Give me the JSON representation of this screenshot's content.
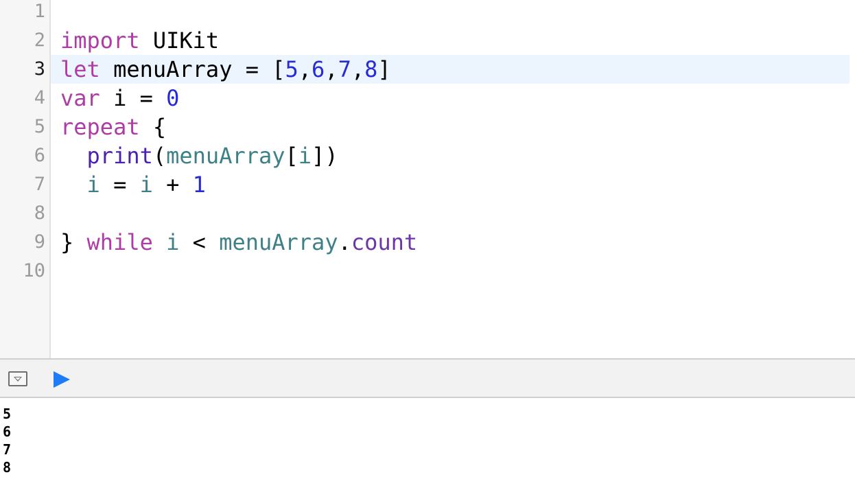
{
  "editor": {
    "line_numbers": [
      "1",
      "2",
      "3",
      "4",
      "5",
      "6",
      "7",
      "8",
      "9",
      "10"
    ],
    "active_line": 3,
    "lines": [
      [],
      [
        {
          "t": "import",
          "c": "kw"
        },
        {
          "t": " UIKit",
          "c": "plain"
        }
      ],
      [
        {
          "t": "let",
          "c": "kw"
        },
        {
          "t": " menuArray = [",
          "c": "plain"
        },
        {
          "t": "5",
          "c": "num"
        },
        {
          "t": ",",
          "c": "plain"
        },
        {
          "t": "6",
          "c": "num"
        },
        {
          "t": ",",
          "c": "plain"
        },
        {
          "t": "7",
          "c": "num"
        },
        {
          "t": ",",
          "c": "plain"
        },
        {
          "t": "8",
          "c": "num"
        },
        {
          "t": "]",
          "c": "plain"
        }
      ],
      [
        {
          "t": "var",
          "c": "kw"
        },
        {
          "t": " i = ",
          "c": "plain"
        },
        {
          "t": "0",
          "c": "num"
        }
      ],
      [
        {
          "t": "repeat",
          "c": "kw"
        },
        {
          "t": " {",
          "c": "plain"
        }
      ],
      [
        {
          "t": "  ",
          "c": "plain"
        },
        {
          "t": "print",
          "c": "fn"
        },
        {
          "t": "(",
          "c": "plain"
        },
        {
          "t": "menuArray",
          "c": "var"
        },
        {
          "t": "[",
          "c": "plain"
        },
        {
          "t": "i",
          "c": "var"
        },
        {
          "t": "])",
          "c": "plain"
        }
      ],
      [
        {
          "t": "  ",
          "c": "plain"
        },
        {
          "t": "i",
          "c": "var"
        },
        {
          "t": " = ",
          "c": "plain"
        },
        {
          "t": "i",
          "c": "var"
        },
        {
          "t": " + ",
          "c": "plain"
        },
        {
          "t": "1",
          "c": "num"
        }
      ],
      [],
      [
        {
          "t": "} ",
          "c": "plain"
        },
        {
          "t": "while",
          "c": "kw"
        },
        {
          "t": " ",
          "c": "plain"
        },
        {
          "t": "i",
          "c": "var"
        },
        {
          "t": " < ",
          "c": "plain"
        },
        {
          "t": "menuArray",
          "c": "var"
        },
        {
          "t": ".",
          "c": "plain"
        },
        {
          "t": "count",
          "c": "prop"
        }
      ],
      []
    ]
  },
  "debug_bar": {
    "toggle_icon": "toggle-console-icon",
    "run_icon": "play-icon",
    "run_color": "#1f7cf4"
  },
  "console": {
    "output": [
      "5",
      "6",
      "7",
      "8"
    ]
  },
  "colors": {
    "keyword": "#ad3da4",
    "number": "#272ad8",
    "variable": "#3e8087",
    "function": "#4b21b0",
    "property": "#6c36a9",
    "active_line_bg": "#ecf5fe"
  }
}
